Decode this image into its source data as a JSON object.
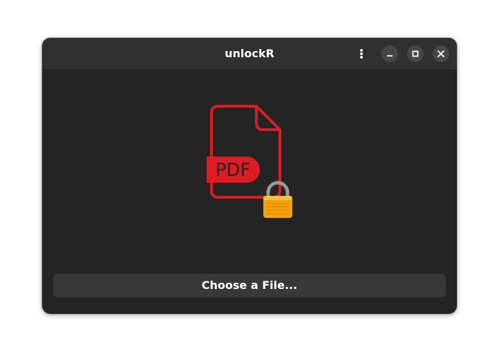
{
  "window": {
    "title": "unlockR"
  },
  "headerbar": {
    "menu_icon": "vertical-dots-icon",
    "minimize_icon": "minimize-icon",
    "maximize_icon": "maximize-icon",
    "close_icon": "close-icon"
  },
  "hero": {
    "badge_text": "PDF",
    "document_icon": "pdf-document-icon",
    "lock_icon": "open-padlock-icon",
    "colors": {
      "document": "#e01b24",
      "badge_text": "#242424",
      "lock_body": "#f6a20e",
      "shackle": "#9a9996"
    }
  },
  "actions": {
    "choose_file_label": "Choose a File..."
  },
  "colors": {
    "window_bg": "#242424",
    "headerbar_bg": "#303030",
    "button_bg": "#383838",
    "text": "#ffffff"
  }
}
